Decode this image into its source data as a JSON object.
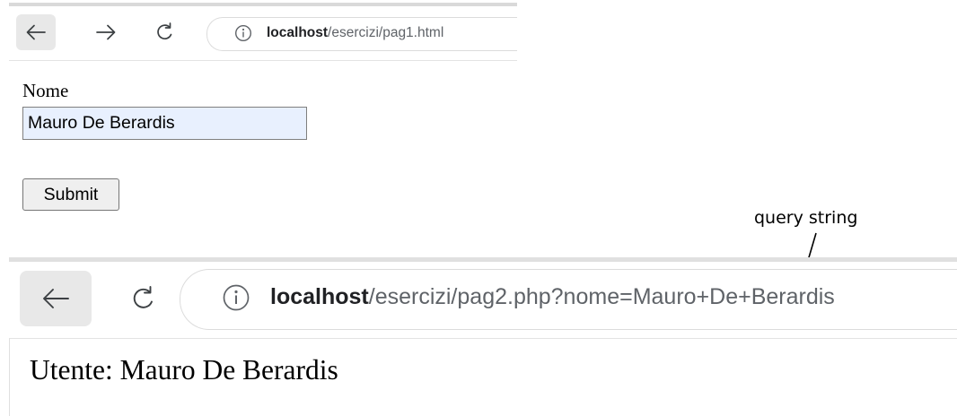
{
  "window1": {
    "url_host": "localhost",
    "url_path": "/esercizi/pag1.html",
    "form": {
      "name_label": "Nome",
      "name_value": "Mauro De Berardis",
      "submit_label": "Submit"
    }
  },
  "annotation": {
    "label": "query string"
  },
  "window2": {
    "url_host": "localhost",
    "url_path": "/esercizi/pag2.php?nome=Mauro+De+Berardis",
    "page_text": "Utente: Mauro De Berardis"
  },
  "icons": [
    "back-arrow-icon",
    "forward-arrow-icon",
    "reload-icon",
    "info-icon",
    "annotation-arrow"
  ]
}
